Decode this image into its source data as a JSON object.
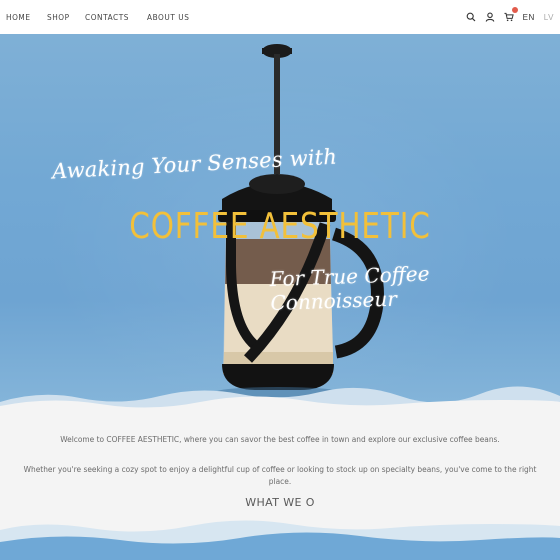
{
  "nav": {
    "items": [
      {
        "label": "HOME"
      },
      {
        "label": "SHOP"
      },
      {
        "label": "CONTACTS"
      },
      {
        "label": "ABOUT US"
      }
    ],
    "icons": [
      "search-icon",
      "user-icon",
      "cart-icon"
    ],
    "languages": [
      {
        "label": "EN",
        "active": true
      },
      {
        "label": "LV",
        "active": false
      }
    ]
  },
  "hero": {
    "tagline_top": "Awaking Your Senses with",
    "brand": "COFFEE AESTHETIC",
    "tagline_bottom": "For True Coffee Connoisseur"
  },
  "intro": {
    "p1": "Welcome to COFFEE AESTHETIC, where you can savor the best coffee in town and explore our exclusive coffee beans.",
    "p2": "Whether you're seeking a cozy spot to enjoy a delightful cup of coffee or looking to stock up on specialty beans, you've come to the right place."
  },
  "section": {
    "heading": "WHAT WE O"
  },
  "colors": {
    "brand": "#f2c03a",
    "hero_blue": "#72a8d4",
    "badge": "#e25b4b"
  }
}
